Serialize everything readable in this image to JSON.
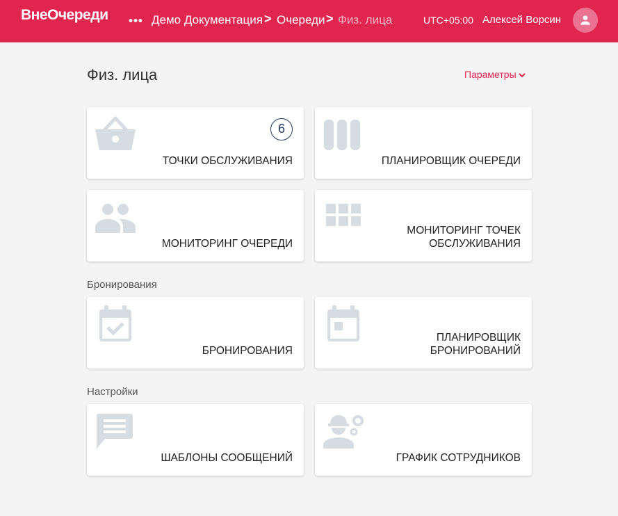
{
  "header": {
    "logo": "ВнеОчереди",
    "menu_dots": "•••",
    "breadcrumbs": [
      "Демо Документация",
      "Очереди",
      "Физ. лица"
    ],
    "separator": ">",
    "timezone": "UTC+05:00",
    "user_name": "Алексей Ворсин"
  },
  "page": {
    "title": "Физ. лица",
    "params_label": "Параметры"
  },
  "colors": {
    "brand": "#e0254f",
    "icon": "#d5dce2",
    "badge": "#1e3a5f"
  },
  "cards": [
    {
      "label": "ТОЧКИ ОБСЛУЖИВАНИЯ",
      "icon": "basket-icon",
      "badge": "6"
    },
    {
      "label": "ПЛАНИРОВЩИК ОЧЕРЕДИ",
      "icon": "columns-icon"
    },
    {
      "label": "МОНИТОРИНГ ОЧЕРЕДИ",
      "icon": "people-icon"
    },
    {
      "label": "МОНИТОРИНГ ТОЧЕК ОБСЛУЖИВАНИЯ",
      "icon": "grid-icon"
    }
  ],
  "sections": [
    {
      "title": "Бронирования",
      "cards": [
        {
          "label": "БРОНИРОВАНИЯ",
          "icon": "calendar-check-icon"
        },
        {
          "label": "ПЛАНИРОВЩИК БРОНИРОВАНИЙ",
          "icon": "calendar-event-icon"
        }
      ]
    },
    {
      "title": "Настройки",
      "cards": [
        {
          "label": "ШАБЛОНЫ СООБЩЕНИЙ",
          "icon": "message-icon"
        },
        {
          "label": "ГРАФИК СОТРУДНИКОВ",
          "icon": "engineering-icon"
        }
      ]
    }
  ]
}
